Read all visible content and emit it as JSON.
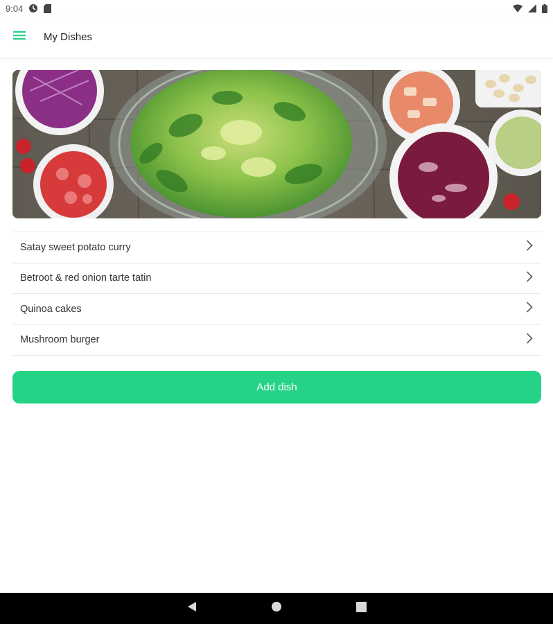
{
  "status_bar": {
    "time": "9:04",
    "left_icons": [
      "data-saver-icon",
      "sd-card-icon"
    ],
    "right_icons": [
      "wifi-icon",
      "signal-icon",
      "battery-icon"
    ]
  },
  "app_bar": {
    "title": "My Dishes",
    "menu_icon": "hamburger-menu-icon",
    "accent_color": "#26d386"
  },
  "hero": {
    "subject": "salad-and-ingredients-photo"
  },
  "dishes": [
    {
      "label": "Satay sweet potato curry"
    },
    {
      "label": "Betroot & red onion tarte tatin"
    },
    {
      "label": "Quinoa cakes"
    },
    {
      "label": "Mushroom burger"
    }
  ],
  "add_button": {
    "label": "Add dish",
    "color": "#26d386"
  },
  "nav_bar": {
    "buttons": [
      "back-icon",
      "home-icon",
      "recents-icon"
    ]
  }
}
